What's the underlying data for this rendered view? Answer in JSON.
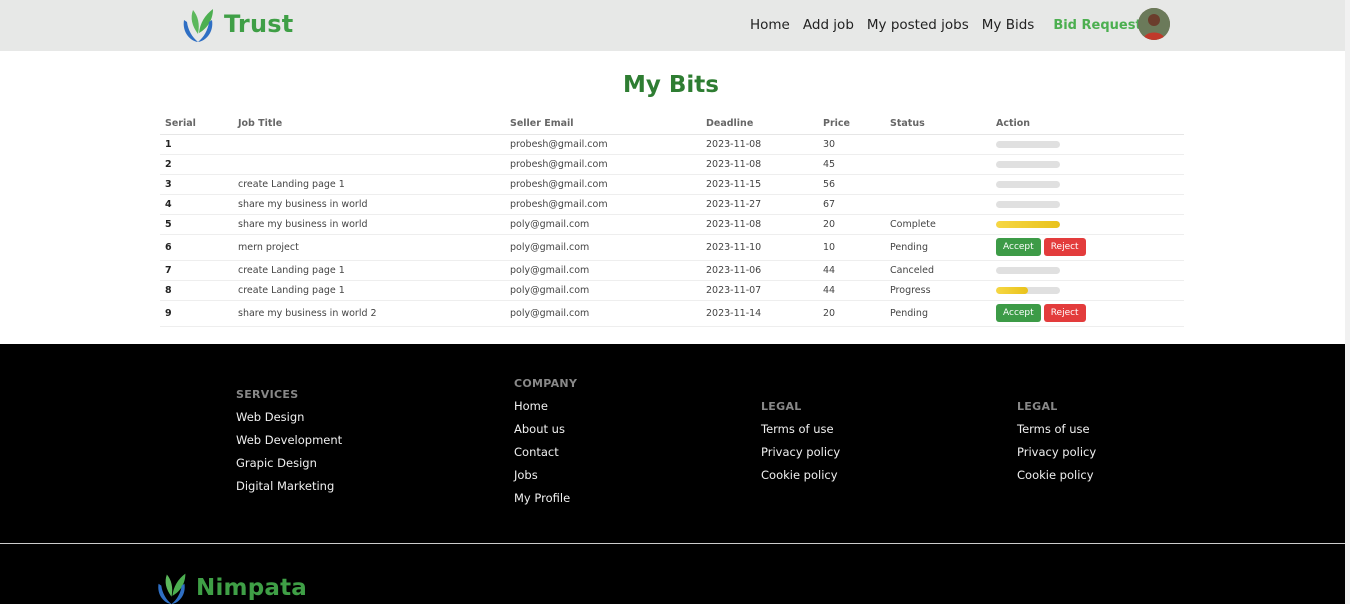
{
  "brand": {
    "name": "Trust"
  },
  "nav": {
    "items": [
      "Home",
      "Add job",
      "My posted jobs",
      "My Bids"
    ],
    "active": "Bid Requests"
  },
  "page": {
    "title": "My Bits"
  },
  "table": {
    "headers": [
      "Serial",
      "Job Title",
      "Seller Email",
      "Deadline",
      "Price",
      "Status",
      "Action"
    ],
    "rows": [
      {
        "serial": "1",
        "title": "",
        "email": "probesh@gmail.com",
        "deadline": "2023-11-08",
        "price": "30",
        "status": "",
        "progress": 0,
        "actions": false
      },
      {
        "serial": "2",
        "title": "",
        "email": "probesh@gmail.com",
        "deadline": "2023-11-08",
        "price": "45",
        "status": "",
        "progress": 0,
        "actions": false
      },
      {
        "serial": "3",
        "title": "create Landing page 1",
        "email": "probesh@gmail.com",
        "deadline": "2023-11-15",
        "price": "56",
        "status": "",
        "progress": 0,
        "actions": false
      },
      {
        "serial": "4",
        "title": "share my business in world",
        "email": "probesh@gmail.com",
        "deadline": "2023-11-27",
        "price": "67",
        "status": "",
        "progress": 0,
        "actions": false
      },
      {
        "serial": "5",
        "title": "share my business in world",
        "email": "poly@gmail.com",
        "deadline": "2023-11-08",
        "price": "20",
        "status": "Complete",
        "progress": 1.0,
        "actions": false
      },
      {
        "serial": "6",
        "title": "mern project",
        "email": "poly@gmail.com",
        "deadline": "2023-11-10",
        "price": "10",
        "status": "Pending",
        "progress": null,
        "actions": true
      },
      {
        "serial": "7",
        "title": "create Landing page 1",
        "email": "poly@gmail.com",
        "deadline": "2023-11-06",
        "price": "44",
        "status": "Canceled",
        "progress": 0,
        "actions": false
      },
      {
        "serial": "8",
        "title": "create Landing page 1",
        "email": "poly@gmail.com",
        "deadline": "2023-11-07",
        "price": "44",
        "status": "Progress",
        "progress": 0.5,
        "actions": false
      },
      {
        "serial": "9",
        "title": "share my business in world 2",
        "email": "poly@gmail.com",
        "deadline": "2023-11-14",
        "price": "20",
        "status": "Pending",
        "progress": null,
        "actions": true
      }
    ],
    "accept_label": "Accept",
    "reject_label": "Reject"
  },
  "footer": {
    "services": {
      "heading": "SERVICES",
      "links": [
        "Web Design",
        "Web Development",
        "Grapic Design",
        "Digital Marketing"
      ]
    },
    "company": {
      "heading": "COMPANY",
      "links": [
        "Home",
        "About us",
        "Contact",
        "Jobs",
        "My Profile"
      ]
    },
    "legal1": {
      "heading": "LEGAL",
      "links": [
        "Terms of use",
        "Privacy policy",
        "Cookie policy"
      ]
    },
    "legal2": {
      "heading": "LEGAL",
      "links": [
        "Terms of use",
        "Privacy policy",
        "Cookie policy"
      ]
    },
    "brand": "Nimpata"
  },
  "colors": {
    "brand_green": "#3f9f46",
    "title_green": "#2e7d32",
    "accept": "#3d9b47",
    "reject": "#e33c3c",
    "progress_fill": "#f6d743"
  }
}
